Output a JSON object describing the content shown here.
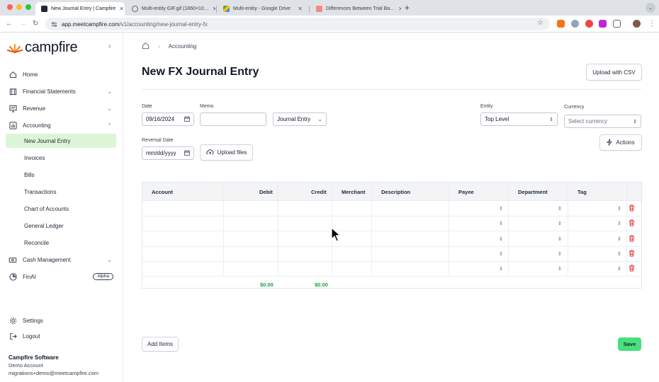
{
  "browser": {
    "tabs": [
      {
        "title": "New Journal Entry | Campfire",
        "active": true
      },
      {
        "title": "Multi-entity GIF.gif (1860×10…",
        "active": false
      },
      {
        "title": "Multi-entity - Google Drive",
        "active": false
      },
      {
        "title": "Differences Between Trial Ba…",
        "active": false
      }
    ],
    "url_host": "app.meetcampfire.com",
    "url_path": "/v1/accounting/new-journal-entry-fx"
  },
  "sidebar": {
    "logo": "campfire",
    "items": [
      {
        "label": "Home",
        "icon": "home-icon"
      },
      {
        "label": "Financial Statements",
        "icon": "building-icon"
      },
      {
        "label": "Revenue",
        "icon": "monitor-icon"
      },
      {
        "label": "Accounting",
        "icon": "chart-icon"
      },
      {
        "label": "Cash Management",
        "icon": "cash-icon"
      },
      {
        "label": "FinAI",
        "icon": "finai-icon",
        "badge": "Alpha"
      }
    ],
    "accounting_sub": [
      "New Journal Entry",
      "Invoices",
      "Bills",
      "Transactions",
      "Chart of Accounts",
      "General Ledger",
      "Reconcile"
    ],
    "settings": "Settings",
    "logout": "Logout",
    "account": {
      "org": "Campfire Software",
      "name": "Demo Account",
      "email": "migrations+demo@meetcampfire.com"
    }
  },
  "main": {
    "breadcrumb": "Accounting",
    "title": "New FX Journal Entry",
    "upload_csv": "Upload with CSV",
    "date_label": "Date",
    "date_value": "09/16/2024",
    "memo_label": "Memo",
    "memo_value": "",
    "entry_type": "Journal Entry",
    "entity_label": "Entity",
    "entity_value": "Top Level",
    "currency_label": "Currency",
    "currency_placeholder": "Select currency",
    "reversal_label": "Reversal Date",
    "reversal_placeholder": "mm/dd/yyyy",
    "upload_files": "Upload files",
    "actions": "Actions",
    "table": {
      "headers": [
        "Account",
        "Debit",
        "Credit",
        "Merchant",
        "Description",
        "Payee",
        "Department",
        "Tag"
      ],
      "row_count": 5,
      "total_debit": "$0.00",
      "total_credit": "$0.00"
    },
    "add_items": "Add Items",
    "save": "Save"
  }
}
